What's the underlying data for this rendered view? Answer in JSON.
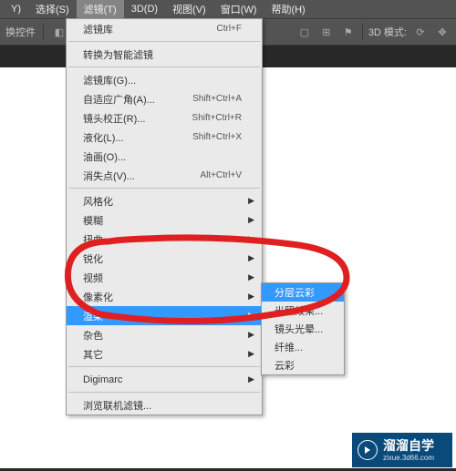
{
  "menubar": {
    "items": [
      {
        "label": "Y)"
      },
      {
        "label": "选择(S)"
      },
      {
        "label": "滤镜(T)"
      },
      {
        "label": "3D(D)"
      },
      {
        "label": "视图(V)"
      },
      {
        "label": "窗口(W)"
      },
      {
        "label": "帮助(H)"
      }
    ],
    "active_index": 2
  },
  "toolbar": {
    "left_label": "换控件",
    "mode_label": "3D 模式:"
  },
  "dropdown": {
    "groups": [
      [
        {
          "label": "滤镜库",
          "shortcut": "Ctrl+F"
        }
      ],
      [
        {
          "label": "转换为智能滤镜"
        }
      ],
      [
        {
          "label": "滤镜库(G)..."
        },
        {
          "label": "自适应广角(A)...",
          "shortcut": "Shift+Ctrl+A"
        },
        {
          "label": "镜头校正(R)...",
          "shortcut": "Shift+Ctrl+R"
        },
        {
          "label": "液化(L)...",
          "shortcut": "Shift+Ctrl+X"
        },
        {
          "label": "油画(O)..."
        },
        {
          "label": "消失点(V)...",
          "shortcut": "Alt+Ctrl+V"
        }
      ],
      [
        {
          "label": "风格化",
          "arrow": true
        },
        {
          "label": "模糊",
          "arrow": true
        },
        {
          "label": "扭曲",
          "arrow": true
        },
        {
          "label": "锐化",
          "arrow": true
        },
        {
          "label": "视频",
          "arrow": true
        },
        {
          "label": "像素化",
          "arrow": true
        },
        {
          "label": "渲染",
          "arrow": true,
          "hover": true
        },
        {
          "label": "杂色",
          "arrow": true
        },
        {
          "label": "其它",
          "arrow": true
        }
      ],
      [
        {
          "label": "Digimarc",
          "arrow": true
        }
      ],
      [
        {
          "label": "浏览联机滤镜..."
        }
      ]
    ]
  },
  "submenu": {
    "items": [
      {
        "label": "分层云彩",
        "hover": true
      },
      {
        "label": "光照效果..."
      },
      {
        "label": "镜头光晕..."
      },
      {
        "label": "纤维..."
      },
      {
        "label": "云彩"
      }
    ]
  },
  "watermark": {
    "main": "溜溜自学",
    "sub": "zixue.3d66.com"
  },
  "annotation_color": "#e02020"
}
